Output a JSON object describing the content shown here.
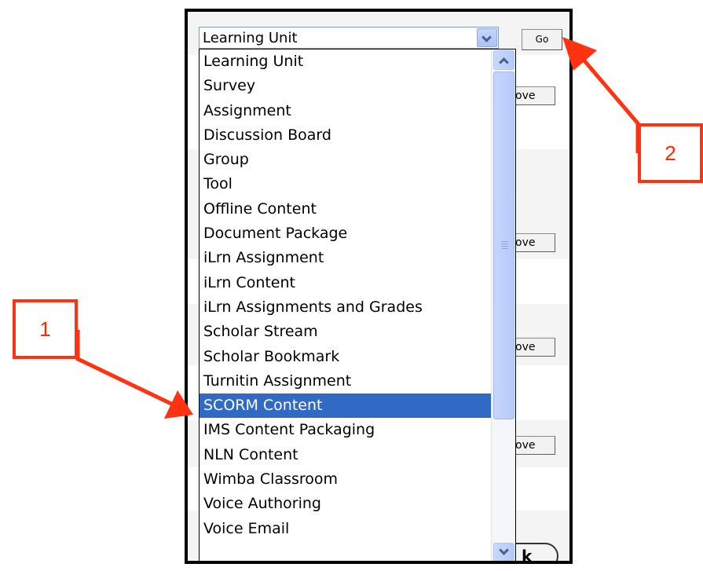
{
  "form": {
    "select_value": "Learning Unit",
    "go_button": "Go",
    "move_button": "ove",
    "ok_button": "k"
  },
  "dropdown": {
    "options": [
      "Learning Unit",
      "Survey",
      "Assignment",
      "Discussion Board",
      "Group",
      "Tool",
      "Offline Content",
      "Document Package",
      "iLrn Assignment",
      "iLrn Content",
      "iLrn Assignments and Grades",
      "Scholar Stream",
      "Scholar Bookmark",
      "Turnitin Assignment",
      "SCORM Content",
      "IMS Content Packaging",
      "NLN Content",
      "Wimba Classroom",
      "Voice Authoring",
      "Voice Email"
    ],
    "selected": "SCORM Content",
    "highlight_color": "#316ac5"
  },
  "annotations": {
    "callout_1": "1",
    "callout_2": "2",
    "color": "#ff3311"
  }
}
